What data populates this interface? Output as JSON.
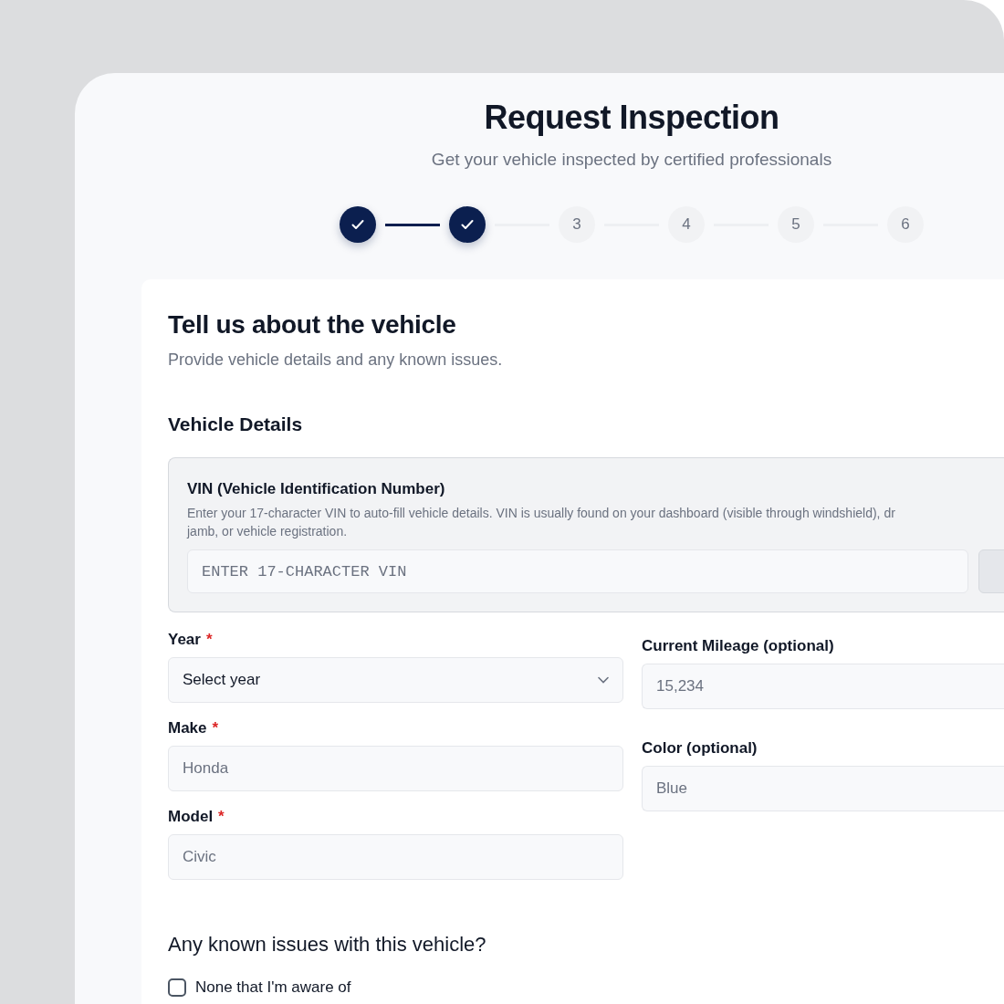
{
  "page": {
    "title": "Request Inspection",
    "subtitle": "Get your vehicle inspected by certified professionals"
  },
  "steps": [
    {
      "completed": true
    },
    {
      "completed": true
    },
    {
      "label": "3",
      "completed": false
    },
    {
      "label": "4",
      "completed": false
    },
    {
      "label": "5",
      "completed": false
    },
    {
      "label": "6",
      "completed": false
    }
  ],
  "card": {
    "title": "Tell us about the vehicle",
    "description": "Provide vehicle details and any known issues.",
    "section_title": "Vehicle Details"
  },
  "vin": {
    "label": "VIN (Vehicle Identification Number)",
    "help_lines": [
      "Enter your 17-character VIN to auto-fill vehicle details. VIN is usually found on your dashboard (visible through windshield), dr",
      "jamb, or vehicle registration."
    ],
    "placeholder": "ENTER 17-CHARACTER VIN"
  },
  "left_fields": [
    {
      "label": "Year",
      "required_mark": "*",
      "kind": "select",
      "value": "Select year"
    },
    {
      "label": "Make",
      "required_mark": "*",
      "kind": "text",
      "placeholder": "Honda"
    },
    {
      "label": "Model",
      "required_mark": "*",
      "kind": "text",
      "placeholder": "Civic"
    }
  ],
  "right_fields": [
    {
      "label": "Current Mileage (optional)",
      "kind": "text",
      "placeholder": "15,234"
    },
    {
      "label": "Color (optional)",
      "kind": "text",
      "placeholder": "Blue"
    }
  ],
  "issues": {
    "title": "Any known issues with this vehicle?",
    "options": [
      {
        "label": "None that I'm aware of",
        "checked": false
      }
    ]
  }
}
